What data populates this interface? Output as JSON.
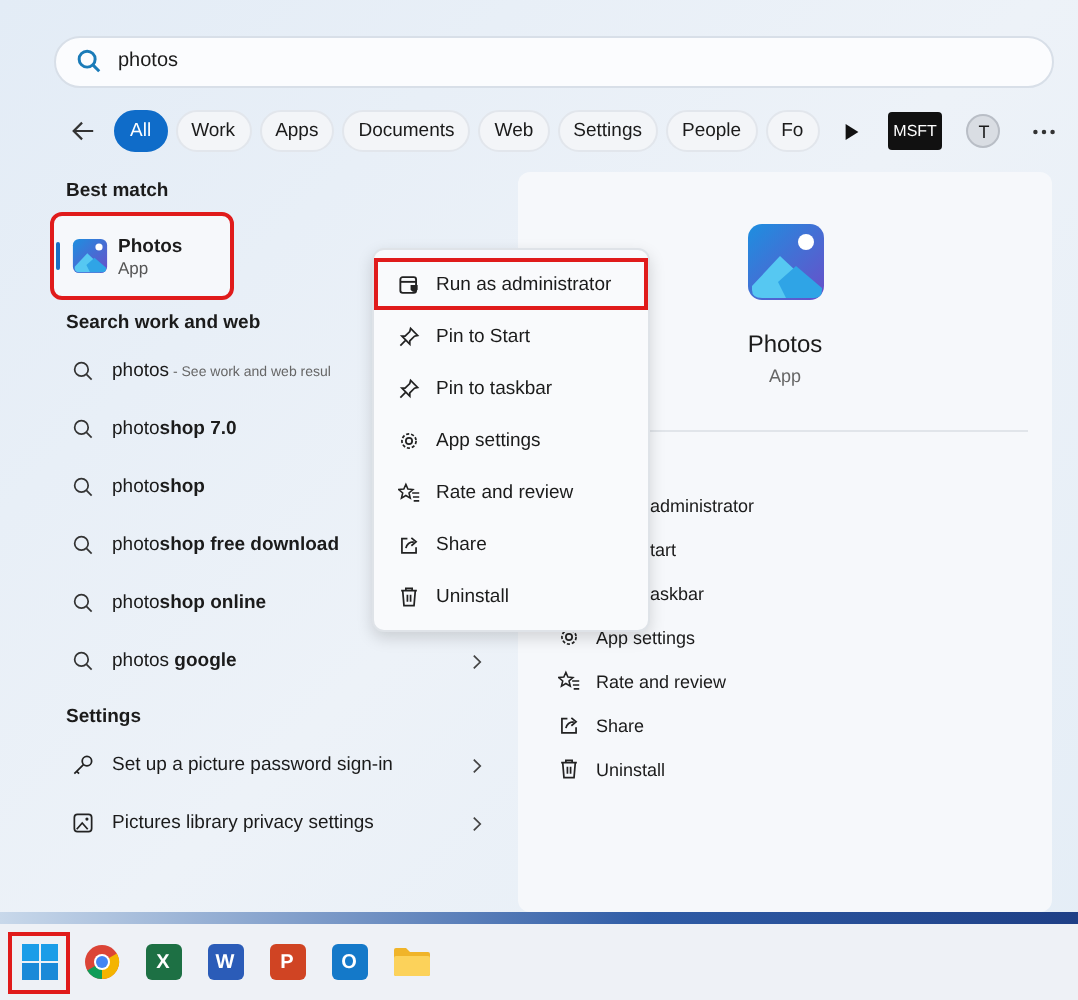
{
  "search": {
    "value": "photos"
  },
  "filters": [
    {
      "label": "All",
      "selected": true
    },
    {
      "label": "Work",
      "selected": false
    },
    {
      "label": "Apps",
      "selected": false
    },
    {
      "label": "Documents",
      "selected": false
    },
    {
      "label": "Web",
      "selected": false
    },
    {
      "label": "Settings",
      "selected": false
    },
    {
      "label": "People",
      "selected": false
    },
    {
      "label": "Fo",
      "selected": false
    }
  ],
  "org_badge": "MSFT",
  "account_initial": "T",
  "best_match": {
    "heading": "Best match",
    "name": "Photos",
    "type": "App",
    "highlighted": true
  },
  "search_web": {
    "heading": "Search work and web",
    "items": [
      {
        "text": "photos",
        "hint": " - See work and web resul",
        "chevron": false
      },
      {
        "text": "photo**shop 7.0**",
        "chevron": false
      },
      {
        "text": "photo**shop**",
        "chevron": false
      },
      {
        "text": "photo**shop free download**",
        "chevron": false
      },
      {
        "text": "photo**shop online**",
        "chevron": false
      },
      {
        "text": "photos **google**",
        "chevron": true
      }
    ]
  },
  "settings": {
    "heading": "Settings",
    "items": [
      {
        "text": "Set up a picture password sign-in",
        "kind": "key"
      },
      {
        "text": "Pictures library privacy settings",
        "kind": "picture"
      }
    ]
  },
  "detail": {
    "name": "Photos",
    "type": "App",
    "covered_actions": [
      "administrator",
      "tart",
      "askbar"
    ],
    "actions": [
      {
        "text": "App settings",
        "kind": "gear"
      },
      {
        "text": "Rate and review",
        "kind": "star"
      },
      {
        "text": "Share",
        "kind": "share"
      },
      {
        "text": "Uninstall",
        "kind": "trash"
      }
    ]
  },
  "context_menu": [
    {
      "label": "Run as administrator",
      "kind": "admin",
      "highlighted": true
    },
    {
      "label": "Pin to Start",
      "kind": "pin",
      "highlighted": false
    },
    {
      "label": "Pin to taskbar",
      "kind": "pin",
      "highlighted": false
    },
    {
      "label": "App settings",
      "kind": "gear",
      "highlighted": false
    },
    {
      "label": "Rate and review",
      "kind": "star",
      "highlighted": false
    },
    {
      "label": "Share",
      "kind": "share",
      "highlighted": false
    },
    {
      "label": "Uninstall",
      "kind": "trash",
      "highlighted": false
    }
  ],
  "taskbar": [
    {
      "kind": "start",
      "highlighted": true
    },
    {
      "kind": "chrome",
      "highlighted": false
    },
    {
      "kind": "office",
      "letter": "X",
      "color": "#1d7044",
      "highlighted": false
    },
    {
      "kind": "office",
      "letter": "W",
      "color": "#2b5cb8",
      "highlighted": false
    },
    {
      "kind": "office",
      "letter": "P",
      "color": "#d04423",
      "highlighted": false
    },
    {
      "kind": "office",
      "letter": "O",
      "color": "#1479c9",
      "highlighted": false
    },
    {
      "kind": "folder",
      "highlighted": false
    }
  ]
}
